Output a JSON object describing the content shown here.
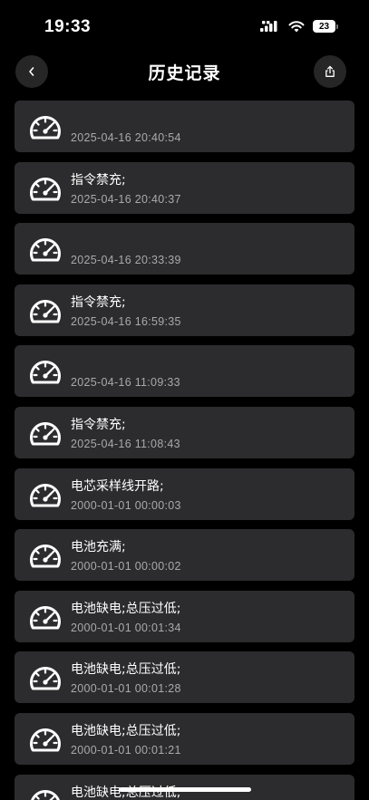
{
  "status_bar": {
    "time": "19:33",
    "battery": "23"
  },
  "nav": {
    "title": "历史记录",
    "back_icon": "chevron-left-icon",
    "share_icon": "share-icon"
  },
  "records": [
    {
      "title": "",
      "time": "2025-04-16 20:40:54"
    },
    {
      "title": "指令禁充;",
      "time": "2025-04-16 20:40:37"
    },
    {
      "title": "",
      "time": "2025-04-16 20:33:39"
    },
    {
      "title": "指令禁充;",
      "time": "2025-04-16 16:59:35"
    },
    {
      "title": "",
      "time": "2025-04-16 11:09:33"
    },
    {
      "title": "指令禁充;",
      "time": "2025-04-16 11:08:43"
    },
    {
      "title": "电芯采样线开路;",
      "time": "2000-01-01 00:00:03"
    },
    {
      "title": "电池充满;",
      "time": "2000-01-01 00:00:02"
    },
    {
      "title": "电池缺电;总压过低;",
      "time": "2000-01-01 00:01:34"
    },
    {
      "title": "电池缺电;总压过低;",
      "time": "2000-01-01 00:01:28"
    },
    {
      "title": "电池缺电;总压过低;",
      "time": "2000-01-01 00:01:21"
    },
    {
      "title": "电池缺电;总压过低;",
      "time": ""
    }
  ],
  "record_icon": "speedometer-icon"
}
